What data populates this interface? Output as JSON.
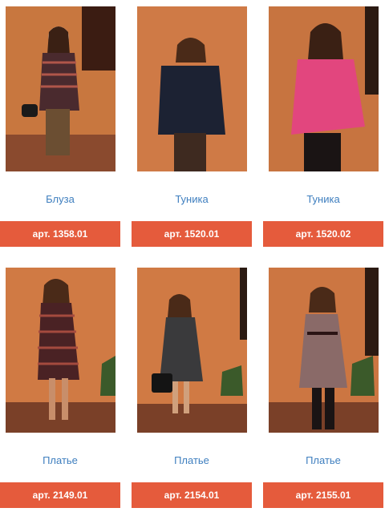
{
  "products": [
    {
      "name": "Блуза",
      "sku": "арт. 1358.01"
    },
    {
      "name": "Туника",
      "sku": "арт. 1520.01"
    },
    {
      "name": "Туника",
      "sku": "арт. 1520.02"
    },
    {
      "name": "Платье",
      "sku": "арт. 2149.01"
    },
    {
      "name": "Платье",
      "sku": "арт. 2154.01"
    },
    {
      "name": "Платье",
      "sku": "арт. 2155.01"
    }
  ],
  "colors": {
    "accent": "#e55b3c",
    "link": "#3f7fbf"
  }
}
